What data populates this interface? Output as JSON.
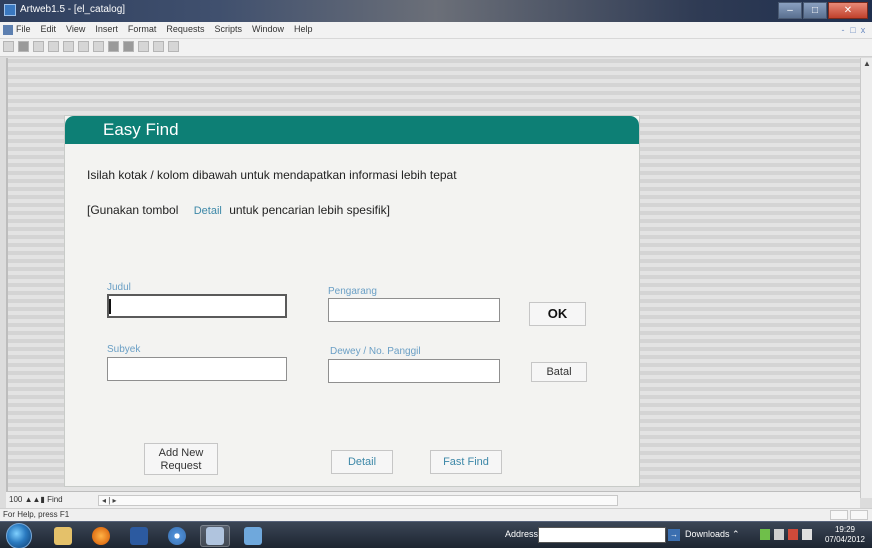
{
  "window": {
    "title": "Artweb1.5 - [el_catalog]",
    "controls": {
      "minimize": "–",
      "maximize": "□",
      "close": "✕"
    }
  },
  "menubar": {
    "items": [
      "File",
      "Edit",
      "View",
      "Insert",
      "Format",
      "Requests",
      "Scripts",
      "Window",
      "Help"
    ],
    "mdi_controls": [
      "-",
      "□",
      "x"
    ]
  },
  "toolbar": {
    "icons": [
      "new-icon",
      "print-icon",
      "preview-icon",
      "cut-icon",
      "copy-icon",
      "paste-icon",
      "undo-icon",
      "layout-icon",
      "browse-icon",
      "find-icon",
      "sort-icon",
      "help-icon"
    ]
  },
  "panel": {
    "title": "Easy Find",
    "instruction": "Isilah kotak / kolom dibawah untuk mendapatkan informasi lebih tepat",
    "hint_prefix": "[Gunakan tombol",
    "hint_link": "Detail",
    "hint_suffix": "untuk pencarian lebih spesifik]",
    "fields": {
      "judul": {
        "label": "Judul",
        "value": ""
      },
      "pengarang": {
        "label": "Pengarang",
        "value": ""
      },
      "subyek": {
        "label": "Subyek",
        "value": ""
      },
      "dewey": {
        "label": "Dewey / No. Panggil",
        "value": ""
      }
    },
    "buttons": {
      "ok": "OK",
      "batal": "Batal",
      "add_new_request": "Add New Request",
      "detail": "Detail",
      "fast_find": "Fast Find"
    }
  },
  "recordbar": {
    "zoom": "100",
    "mode": "Find",
    "nav": "◂ | ▸"
  },
  "statusbar": {
    "text": "For Help, press F1"
  },
  "taskbar": {
    "address_label": "Address",
    "address_value": "",
    "downloads_label": "Downloads",
    "clock_time": "19:29",
    "clock_date": "07/04/2012",
    "apps": [
      "explorer",
      "firefox",
      "media",
      "chrome",
      "filemaker",
      "paint"
    ]
  }
}
